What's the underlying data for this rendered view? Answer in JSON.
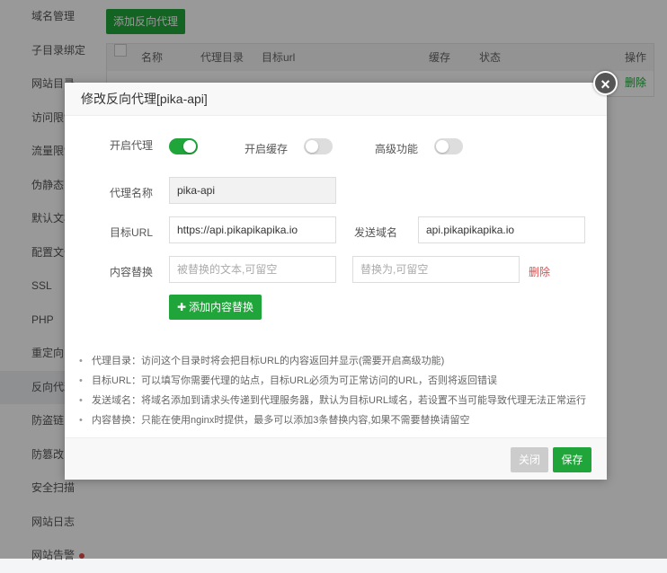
{
  "sidebar": {
    "items": [
      {
        "label": "域名管理"
      },
      {
        "label": "子目录绑定"
      },
      {
        "label": "网站目录"
      },
      {
        "label": "访问限制"
      },
      {
        "label": "流量限制"
      },
      {
        "label": "伪静态"
      },
      {
        "label": "默认文档"
      },
      {
        "label": "配置文件"
      },
      {
        "label": "SSL"
      },
      {
        "label": "PHP"
      },
      {
        "label": "重定向"
      },
      {
        "label": "反向代理"
      },
      {
        "label": "防盗链"
      },
      {
        "label": "防篡改"
      },
      {
        "label": "安全扫描"
      },
      {
        "label": "网站日志"
      },
      {
        "label": "网站告警"
      }
    ]
  },
  "main": {
    "add_proxy_label": "添加反向代理",
    "table": {
      "headers": [
        "名称",
        "代理目录",
        "目标url",
        "缓存",
        "状态",
        "操作"
      ],
      "row_delete_label": "删除"
    }
  },
  "modal": {
    "title": "修改反向代理[pika-api]",
    "close_symbol": "×",
    "toggles": {
      "proxy": {
        "label": "开启代理",
        "on": true
      },
      "cache": {
        "label": "开启缓存",
        "on": false
      },
      "advanced": {
        "label": "高级功能",
        "on": false
      }
    },
    "proxy_name": {
      "label": "代理名称",
      "value": "pika-api"
    },
    "target_url": {
      "label": "目标URL",
      "value": "https://api.pikapikapika.io"
    },
    "send_domain": {
      "label": "发送域名",
      "value": "api.pikapikapika.io"
    },
    "content_replace": {
      "label": "内容替换",
      "from_placeholder": "被替换的文本,可留空",
      "to_placeholder": "替换为,可留空",
      "delete_label": "删除"
    },
    "add_content_label": "添加内容替换",
    "notes": [
      "代理目录：访问这个目录时将会把目标URL的内容返回并显示(需要开启高级功能)",
      "目标URL：可以填写你需要代理的站点，目标URL必须为可正常访问的URL，否则将返回错误",
      "发送域名：将域名添加到请求头传递到代理服务器，默认为目标URL域名，若设置不当可能导致代理无法正常运行",
      "内容替换：只能在使用nginx时提供，最多可以添加3条替换内容,如果不需要替换请留空"
    ],
    "buttons": {
      "close": "关闭",
      "save": "保存"
    }
  },
  "colors": {
    "accent": "#20a53a",
    "danger": "#e14b4b",
    "disabled": "#cccccc"
  }
}
